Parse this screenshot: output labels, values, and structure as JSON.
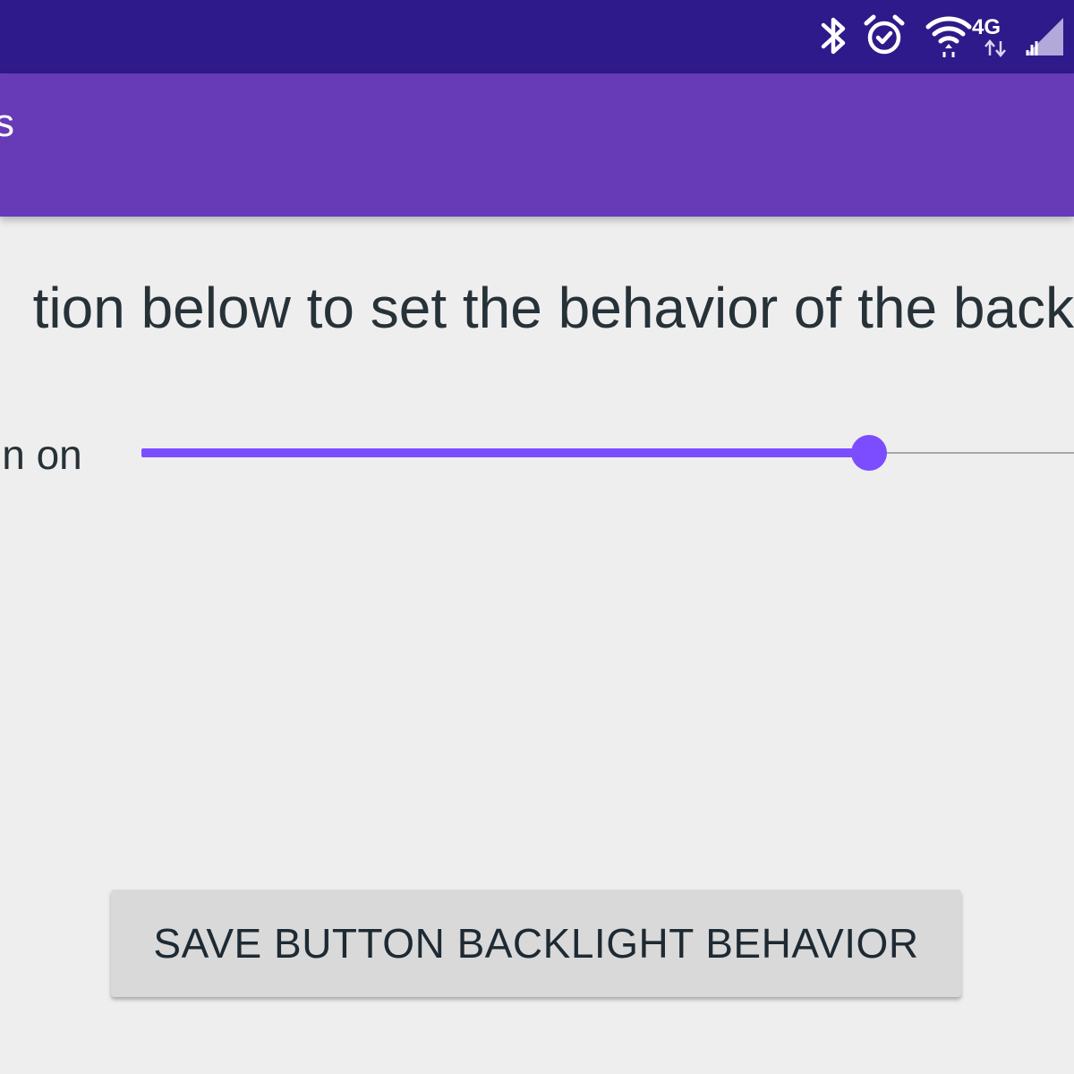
{
  "status_bar": {
    "icons": [
      "bluetooth-icon",
      "alarm-icon",
      "wifi-icon",
      "4g-icon",
      "signal-icon"
    ],
    "network_label": "4G",
    "color": "#2e1a8a"
  },
  "app_bar": {
    "title": "s",
    "color": "#673ab7"
  },
  "content": {
    "instruction": "tion below to set the behavior of the back",
    "slider": {
      "label": "in on",
      "value_fraction": 0.78,
      "accent_color": "#7c4dff"
    },
    "save_button_label": "SAVE BUTTON BACKLIGHT BEHAVIOR"
  }
}
